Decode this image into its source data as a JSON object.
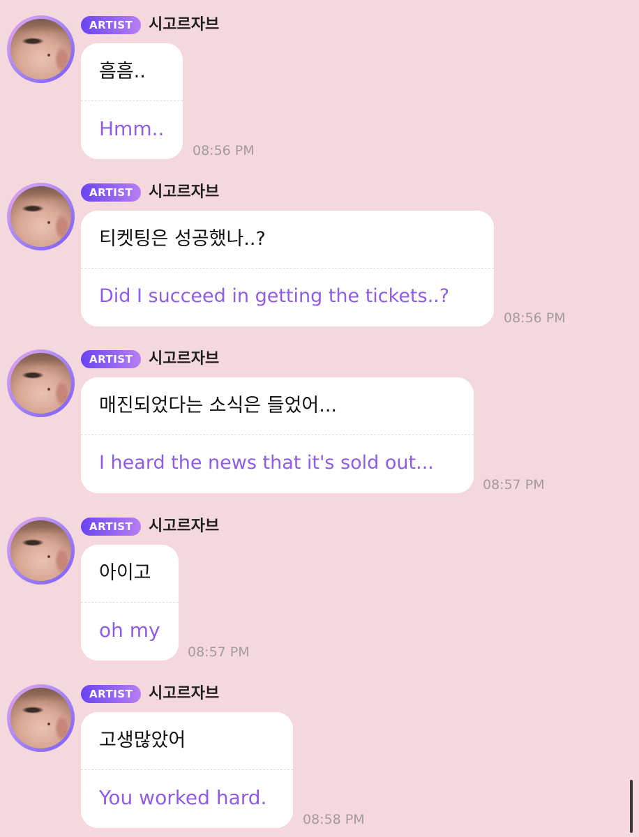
{
  "chat": {
    "messages": [
      {
        "badge": "ARTIST",
        "name": "시고르자브",
        "text": "흠흠..",
        "translation": "Hmm..",
        "time": "08:56 PM"
      },
      {
        "badge": "ARTIST",
        "name": "시고르자브",
        "text": "티켓팅은 성공했나..?",
        "translation": "Did I succeed in getting the tickets..?",
        "time": "08:56 PM"
      },
      {
        "badge": "ARTIST",
        "name": "시고르자브",
        "text": "매진되었다는 소식은 들었어...",
        "translation": "I heard the news that it's sold out...",
        "time": "08:57 PM"
      },
      {
        "badge": "ARTIST",
        "name": "시고르자브",
        "text": "아이고",
        "translation": "oh my",
        "time": "08:57 PM"
      },
      {
        "badge": "ARTIST",
        "name": "시고르자브",
        "text": "고생많았어",
        "translation": "You worked hard.",
        "time": "08:58 PM"
      }
    ]
  },
  "colors": {
    "background": "#f4d8de",
    "bubble": "#ffffff",
    "translation_text": "#8f5ce8",
    "badge_gradient_start": "#6a44f0",
    "badge_gradient_end": "#b77ef3",
    "timestamp": "#a39b9d"
  }
}
